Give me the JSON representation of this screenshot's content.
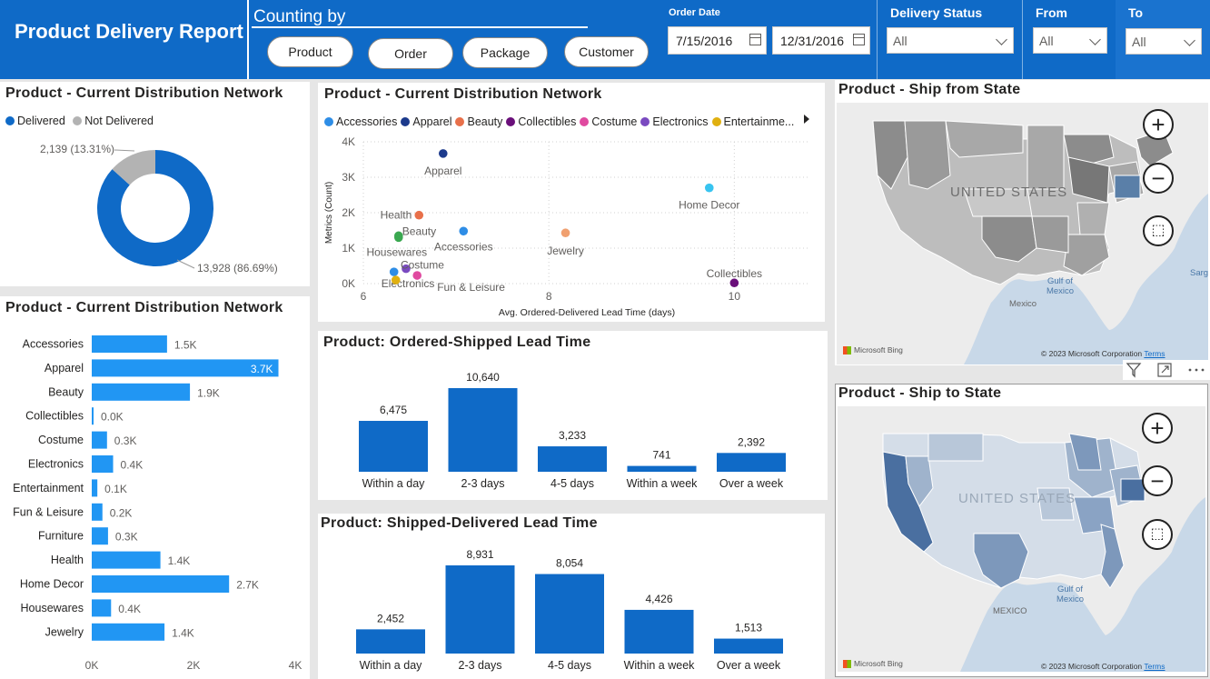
{
  "header": {
    "title": "Product Delivery Report",
    "counting_label": "Counting by",
    "counting_buttons": [
      "Product",
      "Order",
      "Package",
      "Customer"
    ],
    "order_date_label": "Order Date",
    "date_from": "7/15/2016",
    "date_to": "12/31/2016",
    "delivery_status_label": "Delivery Status",
    "delivery_status_value": "All",
    "from_label": "From",
    "from_value": "All",
    "to_label": "To",
    "to_value": "All"
  },
  "donut": {
    "title": "Product - Current Distribution Network",
    "legend": [
      {
        "label": "Delivered",
        "color": "#0f6ac7"
      },
      {
        "label": "Not Delivered",
        "color": "#b3b3b3"
      }
    ],
    "chart_data": {
      "type": "pie",
      "categories": [
        "Delivered",
        "Not Delivered"
      ],
      "values": [
        13928,
        2139
      ],
      "data_labels": [
        "13,928 (86.69%)",
        "2,139 (13.31%)"
      ]
    }
  },
  "scatter": {
    "title": "Product - Current Distribution Network",
    "legend": [
      {
        "label": "Accessories",
        "color": "#2e8de6"
      },
      {
        "label": "Apparel",
        "color": "#1c3a8c"
      },
      {
        "label": "Beauty",
        "color": "#e8704a"
      },
      {
        "label": "Collectibles",
        "color": "#6a0f7a"
      },
      {
        "label": "Costume",
        "color": "#e04aa0"
      },
      {
        "label": "Electronics",
        "color": "#7a4ac0"
      },
      {
        "label": "Entertainme...",
        "color": "#e0b010"
      }
    ],
    "chart_data": {
      "type": "scatter",
      "xlabel": "Avg. Ordered-Delivered Lead Time (days)",
      "ylabel": "Metrics (Count)",
      "x_ticks": [
        "6",
        "8",
        "10"
      ],
      "y_ticks": [
        "0K",
        "1K",
        "2K",
        "3K",
        "4K"
      ],
      "xlim": [
        6,
        10.8
      ],
      "ylim": [
        0,
        4000
      ],
      "points": [
        {
          "name": "Apparel",
          "x": 6.86,
          "y": 3670,
          "color": "#1c3a8c"
        },
        {
          "name": "Home Decor",
          "x": 9.73,
          "y": 2700,
          "color": "#38c4f0"
        },
        {
          "name": "Health",
          "x": 6.6,
          "y": 1930,
          "color": "#e8704a"
        },
        {
          "name": "Beauty",
          "x": 6.38,
          "y": 1350,
          "color": "#3aa850"
        },
        {
          "name": "Accessories",
          "x": 7.08,
          "y": 1480,
          "color": "#2e8de6"
        },
        {
          "name": "Jewelry",
          "x": 8.18,
          "y": 1430,
          "color": "#f0a070"
        },
        {
          "name": "Housewares",
          "x": 6.38,
          "y": 1300,
          "color": "#3aa850"
        },
        {
          "name": "Costume",
          "x": 6.46,
          "y": 420,
          "color": "#7a4ac0"
        },
        {
          "name": "Electronics",
          "x": 6.33,
          "y": 330,
          "color": "#2e8de6"
        },
        {
          "name": "Fun & Leisure",
          "x": 6.58,
          "y": 230,
          "color": "#e04aa0"
        },
        {
          "name": "",
          "x": 6.35,
          "y": 100,
          "color": "#e0b010"
        },
        {
          "name": "Collectibles",
          "x": 10.0,
          "y": 20,
          "color": "#6a0f7a"
        }
      ]
    }
  },
  "hbar": {
    "title": "Product - Current Distribution Network",
    "chart_data": {
      "type": "bar",
      "orientation": "horizontal",
      "categories": [
        "Accessories",
        "Apparel",
        "Beauty",
        "Collectibles",
        "Costume",
        "Electronics",
        "Entertainment",
        "Fun & Leisure",
        "Furniture",
        "Health",
        "Home Decor",
        "Housewares",
        "Jewelry"
      ],
      "values": [
        1480,
        3670,
        1930,
        20,
        300,
        420,
        110,
        210,
        320,
        1350,
        2700,
        380,
        1430
      ],
      "data_labels": [
        "1.5K",
        "3.7K",
        "1.9K",
        "0.0K",
        "0.3K",
        "0.4K",
        "0.1K",
        "0.2K",
        "0.3K",
        "1.4K",
        "2.7K",
        "0.4K",
        "1.4K"
      ],
      "x_ticks": [
        "0K",
        "2K",
        "4K"
      ],
      "xlim": [
        0,
        4000
      ],
      "color": "#2196f3"
    }
  },
  "ordered_shipped": {
    "title": "Product: Ordered-Shipped Lead Time",
    "chart_data": {
      "type": "bar",
      "categories": [
        "Within a day",
        "2-3 days",
        "4-5 days",
        "Within a week",
        "Over a week"
      ],
      "values": [
        6475,
        10640,
        3233,
        741,
        2392
      ],
      "data_labels": [
        "6,475",
        "10,640",
        "3,233",
        "741",
        "2,392"
      ],
      "color": "#0f6ac7"
    }
  },
  "shipped_delivered": {
    "title": "Product: Shipped-Delivered Lead Time",
    "chart_data": {
      "type": "bar",
      "categories": [
        "Within a day",
        "2-3 days",
        "4-5 days",
        "Within a week",
        "Over a week"
      ],
      "values": [
        2452,
        8931,
        8054,
        4426,
        1513
      ],
      "data_labels": [
        "2,452",
        "8,931",
        "8,054",
        "4,426",
        "1,513"
      ],
      "color": "#0f6ac7"
    }
  },
  "map_from": {
    "title": "Product - Ship from State",
    "country_label": "UNITED STATES",
    "gulf_label": "Gulf of\nMexico",
    "mexico_label": "Mexico",
    "sargasso_label": "Sarg",
    "bing_label": "Microsoft Bing",
    "copyright": "© 2023 Microsoft Corporation",
    "terms": "Terms"
  },
  "map_to": {
    "title": "Product - Ship to State",
    "country_label": "UNITED STATES",
    "gulf_label": "Gulf of\nMexico",
    "mexico_label": "MEXICO",
    "bing_label": "Microsoft Bing",
    "copyright": "© 2023 Microsoft Corporation",
    "terms": "Terms"
  },
  "icons": [
    "filter-icon",
    "focus-mode-icon",
    "more-options-icon",
    "zoom-in-icon",
    "zoom-out-icon",
    "select-area-icon",
    "calendar-icon",
    "chevron-down-icon"
  ]
}
